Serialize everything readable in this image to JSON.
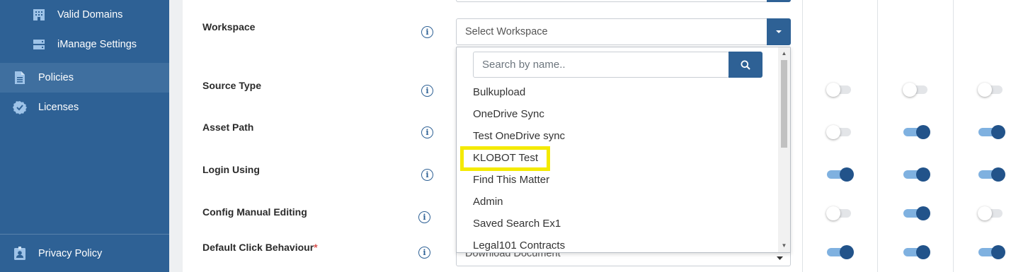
{
  "sidebar": {
    "items": [
      {
        "label": "Valid Domains",
        "icon": "building-icon"
      },
      {
        "label": "iManage Settings",
        "icon": "server-icon"
      },
      {
        "label": "Policies",
        "icon": "document-icon"
      },
      {
        "label": "Licenses",
        "icon": "badge-check-icon"
      },
      {
        "label": "Privacy Policy",
        "icon": "id-badge-icon"
      }
    ]
  },
  "form": {
    "rows": [
      {
        "label": "Workspace"
      },
      {
        "label": "Source Type"
      },
      {
        "label": "Asset Path"
      },
      {
        "label": "Login Using"
      },
      {
        "label": "Config Manual Editing"
      },
      {
        "label": "Default Click Behaviour",
        "required_mark": "*"
      }
    ],
    "info_glyph": "i",
    "workspace_select": {
      "placeholder": "Select Workspace"
    },
    "default_click_select": {
      "value": "Download Document"
    }
  },
  "dropdown": {
    "search_placeholder": "Search by name..",
    "options": [
      "Bulkupload",
      "OneDrive Sync",
      "Test OneDrive sync",
      "KLOBOT Test",
      "Find This Matter",
      "Admin",
      "Saved Search Ex1",
      "Legal101 Contracts"
    ],
    "highlighted": "KLOBOT Test"
  },
  "toggles": {
    "source_type": [
      false,
      false,
      false
    ],
    "asset_path": [
      false,
      true,
      true
    ],
    "login_using": [
      true,
      true,
      true
    ],
    "config_manual_editing": [
      false,
      true,
      false
    ],
    "default_click_behaviour": [
      true,
      true,
      true
    ]
  },
  "colors": {
    "sidebar": "#2e6195",
    "accent": "#2e6195",
    "highlight": "#f4ea00",
    "toggle_on": "#22538a"
  }
}
